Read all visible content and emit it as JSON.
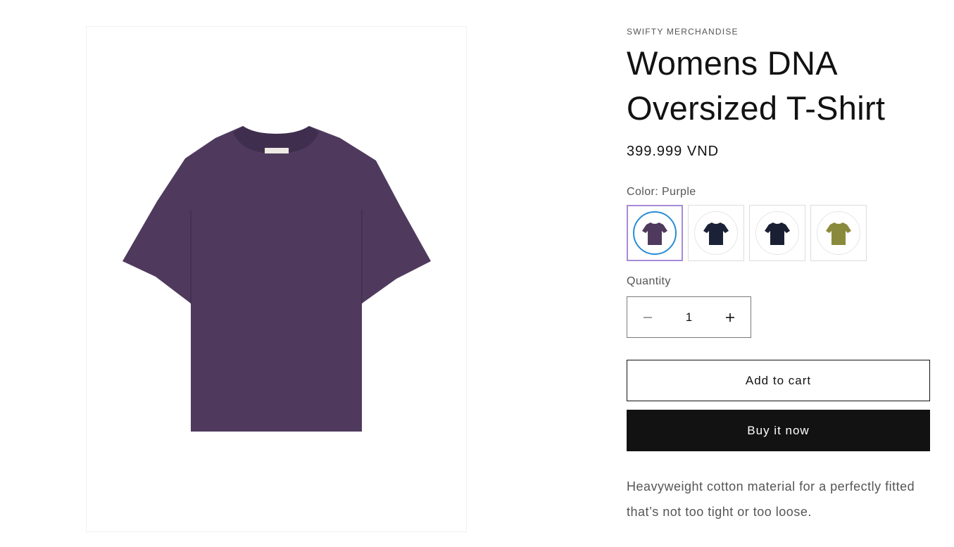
{
  "product": {
    "vendor": "SWIFTY MERCHANDISE",
    "title": "Womens DNA Oversized T-Shirt",
    "price": "399.999 VND",
    "description": "Heavyweight cotton material for a perfectly fitted that’s not too tight or too loose.",
    "image_color": "#4f3a5e"
  },
  "variant": {
    "label": "Color:",
    "selected": "Purple",
    "swatches": [
      {
        "name": "Purple",
        "color": "#4f3a5e"
      },
      {
        "name": "Navy",
        "color": "#1b2238"
      },
      {
        "name": "Navy",
        "color": "#1a1f33"
      },
      {
        "name": "Olive",
        "color": "#8a8a3c"
      }
    ]
  },
  "quantity": {
    "label": "Quantity",
    "value": "1",
    "decrease_icon": "minus-icon",
    "increase_icon": "plus-icon"
  },
  "actions": {
    "add_to_cart": "Add to cart",
    "buy_now": "Buy it now"
  }
}
